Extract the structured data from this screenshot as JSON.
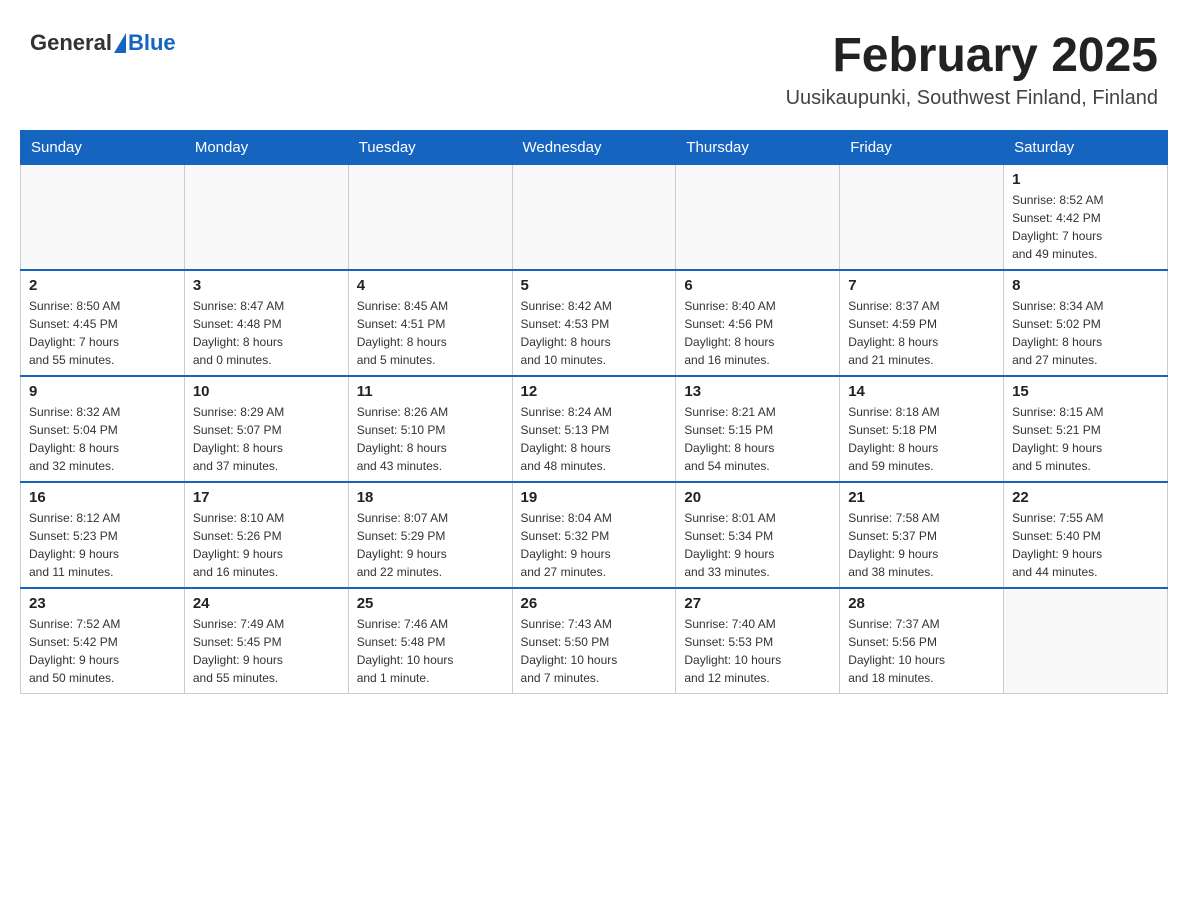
{
  "header": {
    "logo_general": "General",
    "logo_blue": "Blue",
    "month_title": "February 2025",
    "location": "Uusikaupunki, Southwest Finland, Finland"
  },
  "calendar": {
    "days_of_week": [
      "Sunday",
      "Monday",
      "Tuesday",
      "Wednesday",
      "Thursday",
      "Friday",
      "Saturday"
    ],
    "weeks": [
      [
        {
          "day": "",
          "info": ""
        },
        {
          "day": "",
          "info": ""
        },
        {
          "day": "",
          "info": ""
        },
        {
          "day": "",
          "info": ""
        },
        {
          "day": "",
          "info": ""
        },
        {
          "day": "",
          "info": ""
        },
        {
          "day": "1",
          "info": "Sunrise: 8:52 AM\nSunset: 4:42 PM\nDaylight: 7 hours\nand 49 minutes."
        }
      ],
      [
        {
          "day": "2",
          "info": "Sunrise: 8:50 AM\nSunset: 4:45 PM\nDaylight: 7 hours\nand 55 minutes."
        },
        {
          "day": "3",
          "info": "Sunrise: 8:47 AM\nSunset: 4:48 PM\nDaylight: 8 hours\nand 0 minutes."
        },
        {
          "day": "4",
          "info": "Sunrise: 8:45 AM\nSunset: 4:51 PM\nDaylight: 8 hours\nand 5 minutes."
        },
        {
          "day": "5",
          "info": "Sunrise: 8:42 AM\nSunset: 4:53 PM\nDaylight: 8 hours\nand 10 minutes."
        },
        {
          "day": "6",
          "info": "Sunrise: 8:40 AM\nSunset: 4:56 PM\nDaylight: 8 hours\nand 16 minutes."
        },
        {
          "day": "7",
          "info": "Sunrise: 8:37 AM\nSunset: 4:59 PM\nDaylight: 8 hours\nand 21 minutes."
        },
        {
          "day": "8",
          "info": "Sunrise: 8:34 AM\nSunset: 5:02 PM\nDaylight: 8 hours\nand 27 minutes."
        }
      ],
      [
        {
          "day": "9",
          "info": "Sunrise: 8:32 AM\nSunset: 5:04 PM\nDaylight: 8 hours\nand 32 minutes."
        },
        {
          "day": "10",
          "info": "Sunrise: 8:29 AM\nSunset: 5:07 PM\nDaylight: 8 hours\nand 37 minutes."
        },
        {
          "day": "11",
          "info": "Sunrise: 8:26 AM\nSunset: 5:10 PM\nDaylight: 8 hours\nand 43 minutes."
        },
        {
          "day": "12",
          "info": "Sunrise: 8:24 AM\nSunset: 5:13 PM\nDaylight: 8 hours\nand 48 minutes."
        },
        {
          "day": "13",
          "info": "Sunrise: 8:21 AM\nSunset: 5:15 PM\nDaylight: 8 hours\nand 54 minutes."
        },
        {
          "day": "14",
          "info": "Sunrise: 8:18 AM\nSunset: 5:18 PM\nDaylight: 8 hours\nand 59 minutes."
        },
        {
          "day": "15",
          "info": "Sunrise: 8:15 AM\nSunset: 5:21 PM\nDaylight: 9 hours\nand 5 minutes."
        }
      ],
      [
        {
          "day": "16",
          "info": "Sunrise: 8:12 AM\nSunset: 5:23 PM\nDaylight: 9 hours\nand 11 minutes."
        },
        {
          "day": "17",
          "info": "Sunrise: 8:10 AM\nSunset: 5:26 PM\nDaylight: 9 hours\nand 16 minutes."
        },
        {
          "day": "18",
          "info": "Sunrise: 8:07 AM\nSunset: 5:29 PM\nDaylight: 9 hours\nand 22 minutes."
        },
        {
          "day": "19",
          "info": "Sunrise: 8:04 AM\nSunset: 5:32 PM\nDaylight: 9 hours\nand 27 minutes."
        },
        {
          "day": "20",
          "info": "Sunrise: 8:01 AM\nSunset: 5:34 PM\nDaylight: 9 hours\nand 33 minutes."
        },
        {
          "day": "21",
          "info": "Sunrise: 7:58 AM\nSunset: 5:37 PM\nDaylight: 9 hours\nand 38 minutes."
        },
        {
          "day": "22",
          "info": "Sunrise: 7:55 AM\nSunset: 5:40 PM\nDaylight: 9 hours\nand 44 minutes."
        }
      ],
      [
        {
          "day": "23",
          "info": "Sunrise: 7:52 AM\nSunset: 5:42 PM\nDaylight: 9 hours\nand 50 minutes."
        },
        {
          "day": "24",
          "info": "Sunrise: 7:49 AM\nSunset: 5:45 PM\nDaylight: 9 hours\nand 55 minutes."
        },
        {
          "day": "25",
          "info": "Sunrise: 7:46 AM\nSunset: 5:48 PM\nDaylight: 10 hours\nand 1 minute."
        },
        {
          "day": "26",
          "info": "Sunrise: 7:43 AM\nSunset: 5:50 PM\nDaylight: 10 hours\nand 7 minutes."
        },
        {
          "day": "27",
          "info": "Sunrise: 7:40 AM\nSunset: 5:53 PM\nDaylight: 10 hours\nand 12 minutes."
        },
        {
          "day": "28",
          "info": "Sunrise: 7:37 AM\nSunset: 5:56 PM\nDaylight: 10 hours\nand 18 minutes."
        },
        {
          "day": "",
          "info": ""
        }
      ]
    ]
  }
}
